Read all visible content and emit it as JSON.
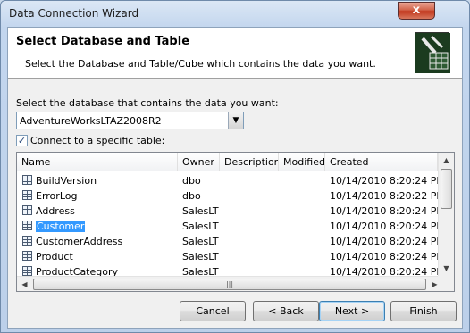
{
  "window": {
    "title": "Data Connection Wizard",
    "close_glyph": "x"
  },
  "header": {
    "title": "Select Database and Table",
    "subtitle": "Select the Database and Table/Cube which contains the data you want.",
    "icon": "wizard-plug-icon"
  },
  "database": {
    "label": "Select the database that contains the data you want:",
    "selected": "AdventureWorksLTAZ2008R2",
    "dropdown_glyph": "▼"
  },
  "specific_table": {
    "checked": true,
    "check_glyph": "✓",
    "label": "Connect to a specific table:"
  },
  "table": {
    "columns": [
      "Name",
      "Owner",
      "Description",
      "Modified",
      "Created"
    ],
    "rows": [
      {
        "name": "BuildVersion",
        "owner": "dbo",
        "description": "",
        "modified": "",
        "created": "10/14/2010 8:20:24 PM",
        "selected": false
      },
      {
        "name": "ErrorLog",
        "owner": "dbo",
        "description": "",
        "modified": "",
        "created": "10/14/2010 8:20:22 PM",
        "selected": false
      },
      {
        "name": "Address",
        "owner": "SalesLT",
        "description": "",
        "modified": "",
        "created": "10/14/2010 8:20:24 PM",
        "selected": false
      },
      {
        "name": "Customer",
        "owner": "SalesLT",
        "description": "",
        "modified": "",
        "created": "10/14/2010 8:20:24 PM",
        "selected": true
      },
      {
        "name": "CustomerAddress",
        "owner": "SalesLT",
        "description": "",
        "modified": "",
        "created": "10/14/2010 8:20:24 PM",
        "selected": false
      },
      {
        "name": "Product",
        "owner": "SalesLT",
        "description": "",
        "modified": "",
        "created": "10/14/2010 8:20:24 PM",
        "selected": false
      },
      {
        "name": "ProductCategory",
        "owner": "SalesLT",
        "description": "",
        "modified": "",
        "created": "10/14/2010 8:20:24 PM",
        "selected": false
      }
    ]
  },
  "buttons": {
    "cancel": "Cancel",
    "back": "< Back",
    "next": "Next >",
    "finish": "Finish"
  },
  "colors": {
    "selection": "#3399ff",
    "close_button": "#c2391f"
  }
}
